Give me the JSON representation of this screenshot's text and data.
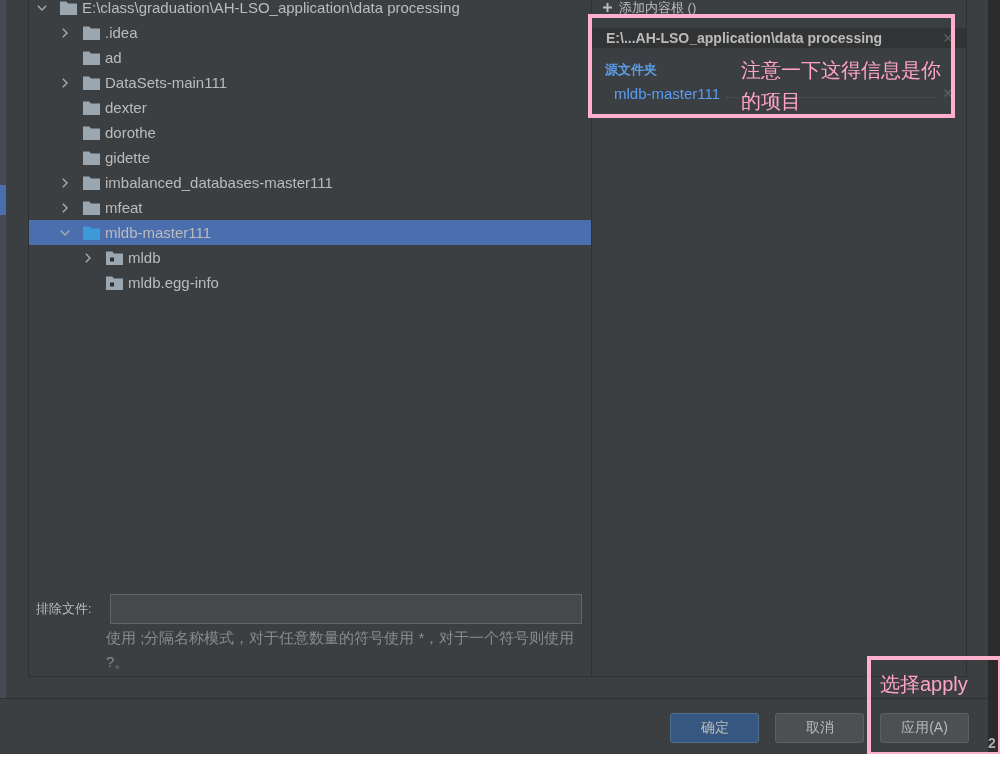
{
  "side_panel": {
    "highlight": true
  },
  "tree": {
    "items": [
      {
        "label": "E:\\class\\graduation\\AH-LSO_application\\data processing",
        "kind": "folder",
        "expandable": true,
        "expanded": true,
        "selected": false,
        "children": [
          {
            "label": ".idea",
            "kind": "folder",
            "expandable": true,
            "expanded": false,
            "selected": false
          },
          {
            "label": "ad",
            "kind": "folder",
            "expandable": false,
            "selected": false
          },
          {
            "label": "DataSets-main111",
            "kind": "folder",
            "expandable": true,
            "expanded": false,
            "selected": false
          },
          {
            "label": "dexter",
            "kind": "folder",
            "expandable": false,
            "selected": false
          },
          {
            "label": "dorothe",
            "kind": "folder",
            "expandable": false,
            "selected": false
          },
          {
            "label": "gidette",
            "kind": "folder",
            "expandable": false,
            "selected": false
          },
          {
            "label": "imbalanced_databases-master111",
            "kind": "folder",
            "expandable": true,
            "expanded": false,
            "selected": false
          },
          {
            "label": "mfeat",
            "kind": "folder",
            "expandable": true,
            "expanded": false,
            "selected": false
          },
          {
            "label": "mldb-master111",
            "kind": "source-root",
            "expandable": true,
            "expanded": true,
            "selected": true,
            "children": [
              {
                "label": "mldb",
                "kind": "package",
                "expandable": true,
                "expanded": false,
                "selected": false
              },
              {
                "label": "mldb.egg-info",
                "kind": "package",
                "expandable": false,
                "selected": false
              }
            ]
          }
        ]
      }
    ]
  },
  "exclude_files": {
    "label": "排除文件:",
    "hint": "使用 ;分隔名称模式，对于任意数量的符号使用 *，对于一个符号则使用 ?。"
  },
  "content_roots": {
    "add_label": "添加内容根 ()",
    "root_path": "E:\\...AH-LSO_application\\data processing",
    "sections": [
      {
        "title": "源文件夹",
        "entries": [
          "mldb-master111"
        ]
      }
    ]
  },
  "buttons": [
    {
      "label": "确定",
      "default": true
    },
    {
      "label": "取消",
      "default": false
    },
    {
      "label": "应用(A)",
      "default": false
    }
  ],
  "annotations": [
    {
      "text": "注意一下这得信息是你的项目"
    },
    {
      "text": "选择apply"
    }
  ],
  "edge_text": "2"
}
